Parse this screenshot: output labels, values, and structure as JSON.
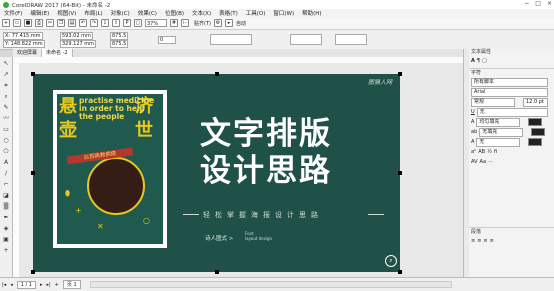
{
  "window": {
    "title": "CorelDRAW 2017 (64-Bit) - 未命名 -2",
    "controls": [
      "−",
      "□",
      "×"
    ]
  },
  "menu": [
    "文件(F)",
    "编辑(E)",
    "视图(V)",
    "布局(L)",
    "对象(C)",
    "效果(C)",
    "位图(B)",
    "文本(X)",
    "表格(T)",
    "工具(O)",
    "窗口(W)",
    "帮助(H)"
  ],
  "toolbar": {
    "zoom": "37%",
    "snap": "贴齐(T)",
    "auto": "自动"
  },
  "props": {
    "x": "X: 77.415 mm",
    "y": "Y: 148.822 mm",
    "w": "593.02 mm",
    "h": "329.127 mm",
    "sx": "875.5",
    "sy": "875.5",
    "pct": "%",
    "angle": "0"
  },
  "doc_tabs": [
    "欢迎屏幕",
    "未命名 -2"
  ],
  "poster": {
    "headline_1": "文字排版",
    "headline_2": "设计思路",
    "subline": "轻松掌握海报设计思路",
    "author": "诗人图式 >",
    "small_en": "Font\nlayout design",
    "watermark": "图猫人网",
    "art_big_1": "悬",
    "art_big_2": "壶",
    "art_big_3": "济",
    "art_big_4": "世",
    "art_eng": "practise medicine in order to help the people",
    "art_band": "治百病救病疫"
  },
  "panel": {
    "title": "文本属性",
    "section_char": "字符",
    "script": "所有脚本",
    "font": "Arial",
    "style": "常规",
    "size": "12.0 pt",
    "underline": "无",
    "fill_label": "均匀填充",
    "bg_label": "无填充",
    "outline_label": "无",
    "section_para": "段落"
  },
  "status": {
    "page_info": "1 / 1",
    "page": "页 1"
  },
  "colors": {
    "poster_bg": "#1f5148",
    "accent": "#e9c81c",
    "red": "#b2372f"
  }
}
